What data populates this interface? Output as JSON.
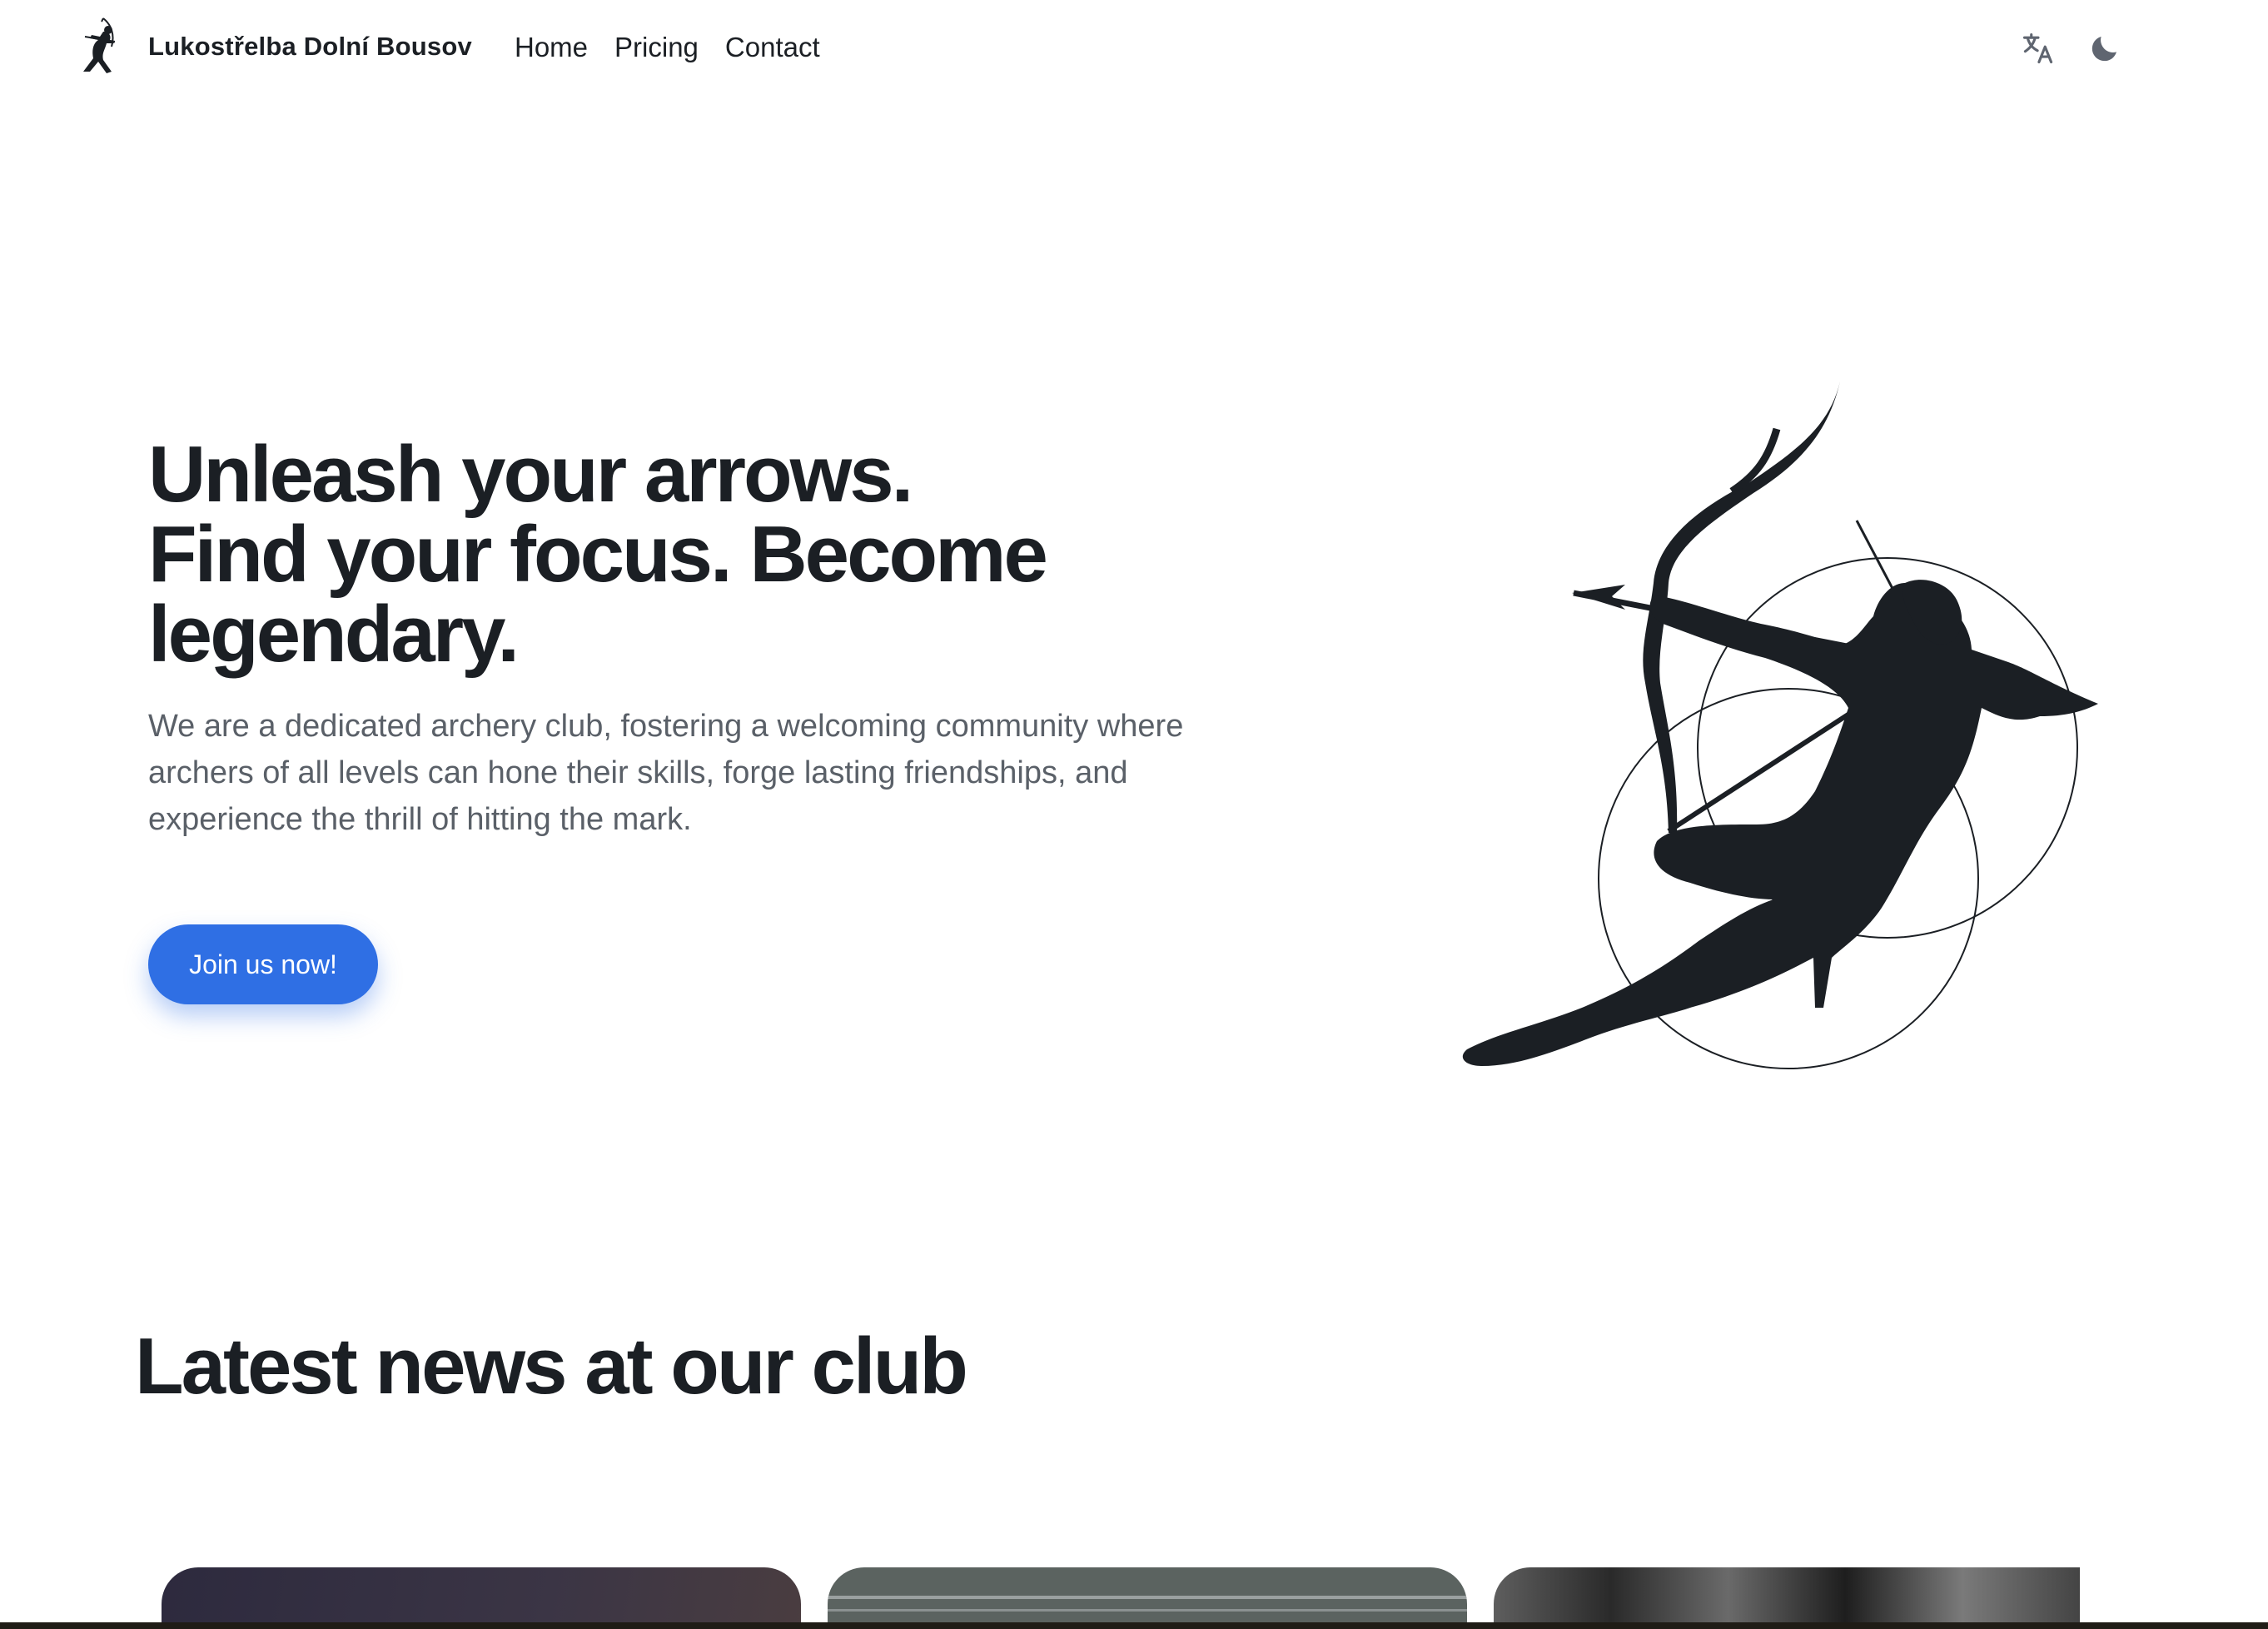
{
  "brand": {
    "name": "Lukostřelba Dolní Bousov",
    "logo_icon": "archer-logo-icon"
  },
  "nav": {
    "links": [
      {
        "label": "Home"
      },
      {
        "label": "Pricing"
      },
      {
        "label": "Contact"
      }
    ],
    "icons": [
      "translate-icon",
      "moon-icon"
    ]
  },
  "hero": {
    "title_lines": [
      "Unleash your arrows.",
      "Find your focus. Become",
      "legendary."
    ],
    "description": "We are a dedicated archery club, fostering a welcoming community where archers of all levels can hone their skills, forge lasting friendships, and experience the thrill of hitting the mark.",
    "cta_label": "Join us now!",
    "illustration": "archer-illustration-icon"
  },
  "news": {
    "title": "Latest news at our club",
    "cards": [
      {
        "image": "news-image-1"
      },
      {
        "image": "news-image-2"
      },
      {
        "image": "news-image-3"
      }
    ]
  },
  "colors": {
    "accent": "#2f6fe4",
    "text": "#1b1f24",
    "muted": "#5a6068"
  }
}
